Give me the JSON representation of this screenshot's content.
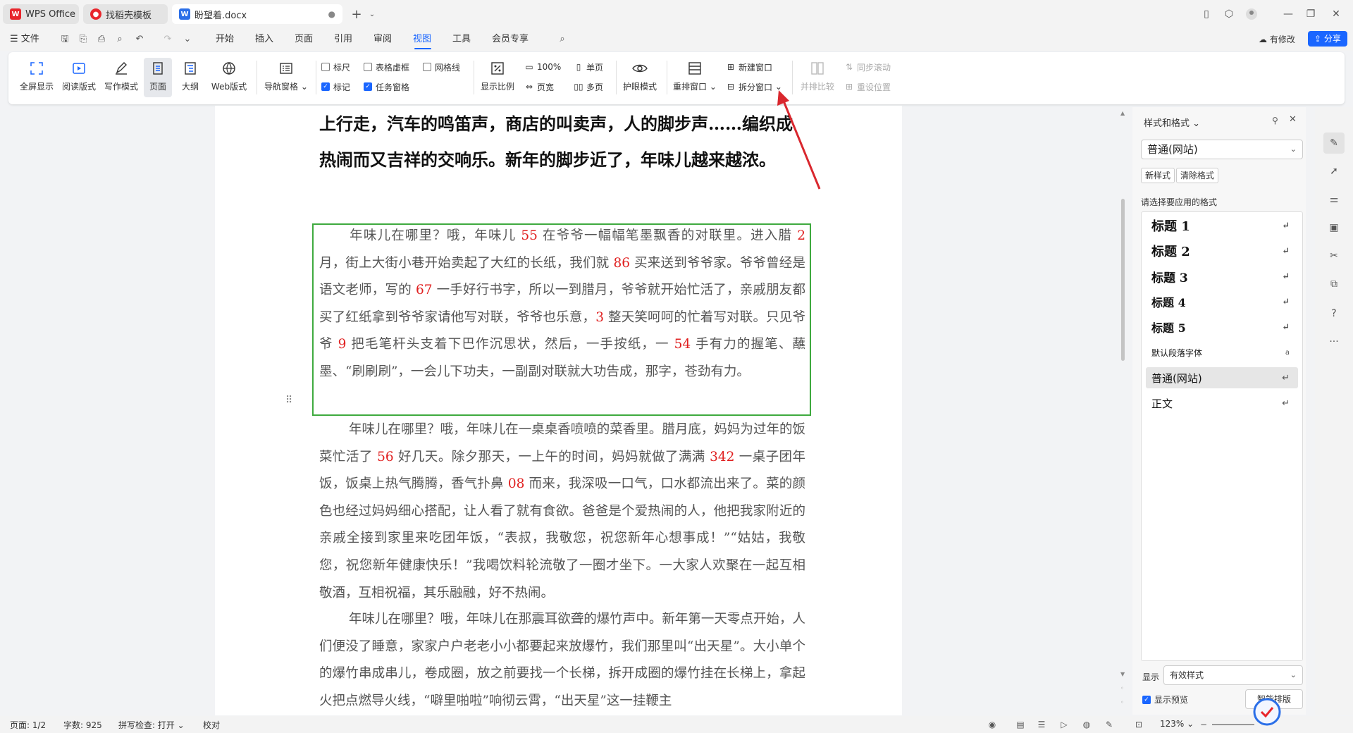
{
  "tabs": [
    {
      "label": "WPS Office"
    },
    {
      "label": "找稻壳模板"
    },
    {
      "label": "盼望着.docx"
    }
  ],
  "menu": {
    "file": "文件",
    "items": [
      "开始",
      "插入",
      "页面",
      "引用",
      "审阅",
      "视图",
      "工具",
      "会员专享"
    ],
    "active": "视图",
    "has_changes": "有修改",
    "share": "分享"
  },
  "ribbon": {
    "fullscreen": "全屏显示",
    "reading": "阅读版式",
    "writing": "写作模式",
    "page": "页面",
    "outline": "大纲",
    "web": "Web版式",
    "nav_pane": "导航窗格",
    "ruler": "标尺",
    "table_gridlines": "表格虚框",
    "gridlines": "网格线",
    "marks": "标记",
    "task_pane": "任务窗格",
    "zoom": "显示比例",
    "zoom_100": "100%",
    "page_width": "页宽",
    "single_page": "单页",
    "multi_page": "多页",
    "eye_care": "护眼模式",
    "arrange": "重排窗口",
    "new_window": "新建窗口",
    "split_window": "拆分窗口",
    "side_by_side": "并排比较",
    "sync_scroll": "同步滚动",
    "reset_position": "重设位置"
  },
  "document": {
    "heading": "上行走，汽车的鸣笛声，商店的叫卖声，人的脚步声……编织成热闹而又吉祥的交响乐。新年的脚步近了，年味儿越来越浓。",
    "p1": [
      {
        "t": "年味儿在哪里？哦，年味儿 "
      },
      {
        "t": "55",
        "red": true
      },
      {
        "t": " 在爷爷一幅幅笔墨飘香的对联里。进入腊 "
      },
      {
        "t": "2",
        "red": true
      },
      {
        "t": " 月，街上大街小巷开始卖起了大红的长纸，我们就 "
      },
      {
        "t": "86",
        "red": true
      },
      {
        "t": " 买来送到爷爷家。爷爷曾经是语文老师，写的 "
      },
      {
        "t": "67",
        "red": true
      },
      {
        "t": " 一手好行书字，所以一到腊月，爷爷就开始忙活了，亲戚朋友都买了红纸拿到爷爷家请他写对联，爷爷也乐意，"
      },
      {
        "t": "3",
        "red": true
      },
      {
        "t": " 整天笑呵呵的忙着写对联。只见爷爷 "
      },
      {
        "t": "9",
        "red": true
      },
      {
        "t": " 把毛笔杆头支着下巴作沉思状，然后，一手按纸，一 "
      },
      {
        "t": "54",
        "red": true
      },
      {
        "t": " 手有力的握笔、蘸墨、“刷刷刷”，一会儿下功夫，一副副对联就大功告成，那字，苍劲有力。"
      }
    ],
    "p2": [
      {
        "t": "年味儿在哪里？哦，年味儿在一桌桌香喷喷的菜香里。腊月底，妈妈为过年的饭菜忙活了 "
      },
      {
        "t": "56",
        "red": true
      },
      {
        "t": " 好几天。除夕那天，一上午的时间，妈妈就做了满满 "
      },
      {
        "t": "342",
        "red": true
      },
      {
        "t": " 一桌子团年饭，饭桌上热气腾腾，香气扑鼻 "
      },
      {
        "t": "08",
        "red": true
      },
      {
        "t": " 而来，我深吸一口气，口水都流出来了。菜的颜色也经过妈妈细心搭配，让人看了就有食欲。爸爸是个爱热闹的人，他把我家附近的亲戚全接到家里来吃团年饭，“表叔，我敬您，祝您新年心想事成！”“姑姑，我敬您，祝您新年健康快乐！”我喝饮料轮流敬了一圈才坐下。一大家人欢聚在一起互相敬酒，互相祝福，其乐融融，好不热闹。"
      }
    ],
    "p3": [
      {
        "t": "年味儿在哪里？哦，年味儿在那震耳欲聋的爆竹声中。新年第一天零点开始，人们便没了睡意，家家户户老老小小都要起来放爆竹，我们那里叫“出天星”。大小单个的爆竹串成串儿，卷成圈，放之前要找一个长梯，拆开成圈的爆竹挂在长梯上，拿起火把点燃导火线，“噼里啪啦”响彻云霄，“出天星”这一挂鞭主"
      }
    ]
  },
  "panel": {
    "title": "样式和格式",
    "current_style": "普通(网站)",
    "new_style": "新样式",
    "clear_format": "清除格式",
    "apply_label": "请选择要应用的格式",
    "styles": [
      {
        "label": "标题 1",
        "ret": "↵"
      },
      {
        "label": "标题 2",
        "ret": "↵"
      },
      {
        "label": "标题 3",
        "ret": "↵"
      },
      {
        "label": "标题 4",
        "ret": "↵"
      },
      {
        "label": "标题 5",
        "ret": "↵"
      },
      {
        "label": "默认段落字体",
        "ret": "a"
      },
      {
        "label": "普通(网站)",
        "ret": "↵"
      },
      {
        "label": "正文",
        "ret": "↵"
      }
    ],
    "show_label": "显示",
    "show_value": "有效样式",
    "preview": "显示预览",
    "smart": "智能排版"
  },
  "status": {
    "page": "页面: 1/2",
    "words": "字数: 925",
    "spell": "拼写检查: 打开",
    "proof": "校对",
    "zoom": "123%"
  },
  "colors": {
    "accent": "#1a66ff",
    "green_box": "#3faa3f",
    "red_num": "#e02020",
    "arrow": "#d9272e"
  }
}
